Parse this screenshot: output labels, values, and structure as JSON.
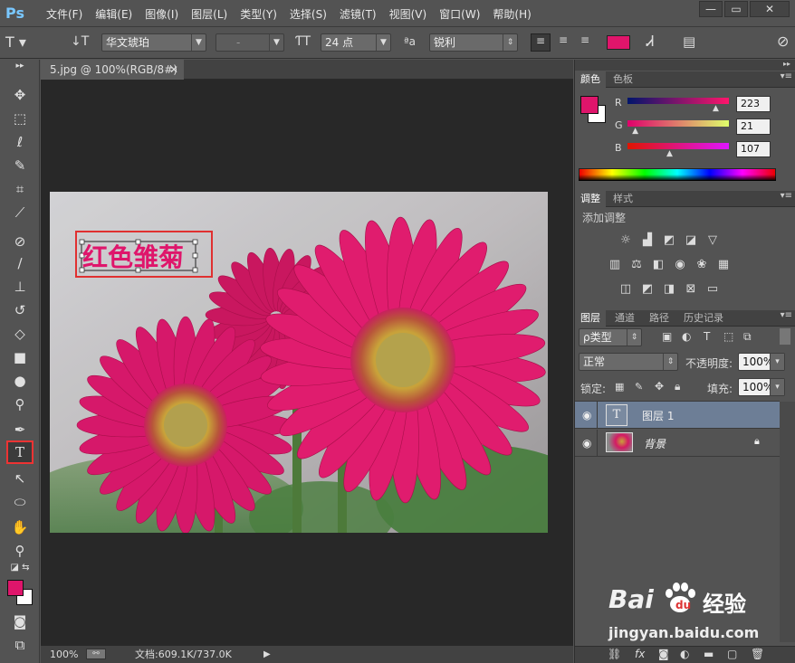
{
  "app": {
    "logo": "Ps"
  },
  "menu": [
    "文件(F)",
    "编辑(E)",
    "图像(I)",
    "图层(L)",
    "类型(Y)",
    "选择(S)",
    "滤镜(T)",
    "视图(V)",
    "窗口(W)",
    "帮助(H)"
  ],
  "window_controls": {
    "minimize": "—",
    "restore": "▭",
    "close": "✕"
  },
  "options": {
    "font_family": "华文琥珀",
    "font_style": "-",
    "font_size": "24 点",
    "aa_label": "ªa",
    "antialias": "锐利",
    "text_color": "#e0156b"
  },
  "document": {
    "tab_title": "5.jpg @ 100%(RGB/8#)",
    "canvas_text": "红色雏菊",
    "zoom": "100%",
    "doc_info": "文档:609.1K/737.0K"
  },
  "color_panel": {
    "tabs": [
      "颜色",
      "色板"
    ],
    "r_label": "R",
    "g_label": "G",
    "b_label": "B",
    "r": "223",
    "g": "21",
    "b": "107",
    "r_frac": 0.875,
    "g_frac": 0.082,
    "b_frac": 0.42,
    "fg_color": "#df156b",
    "bg_color": "#ffffff"
  },
  "adjustments_panel": {
    "tabs": [
      "调整",
      "样式"
    ],
    "add_label": "添加调整"
  },
  "layers_panel": {
    "tabs": [
      "图层",
      "通道",
      "路径",
      "历史记录"
    ],
    "filter_kind": "ρ类型",
    "blend_mode": "正常",
    "opacity_label": "不透明度:",
    "opacity": "100%",
    "lock_label": "锁定:",
    "fill_label": "填充:",
    "fill": "100%",
    "layers": [
      {
        "name": "图层 1",
        "thumb": "T"
      },
      {
        "name": "背景"
      }
    ]
  },
  "watermark": {
    "brand": "Bai",
    "brand2": "经验",
    "url": "jingyan.baidu.com"
  }
}
